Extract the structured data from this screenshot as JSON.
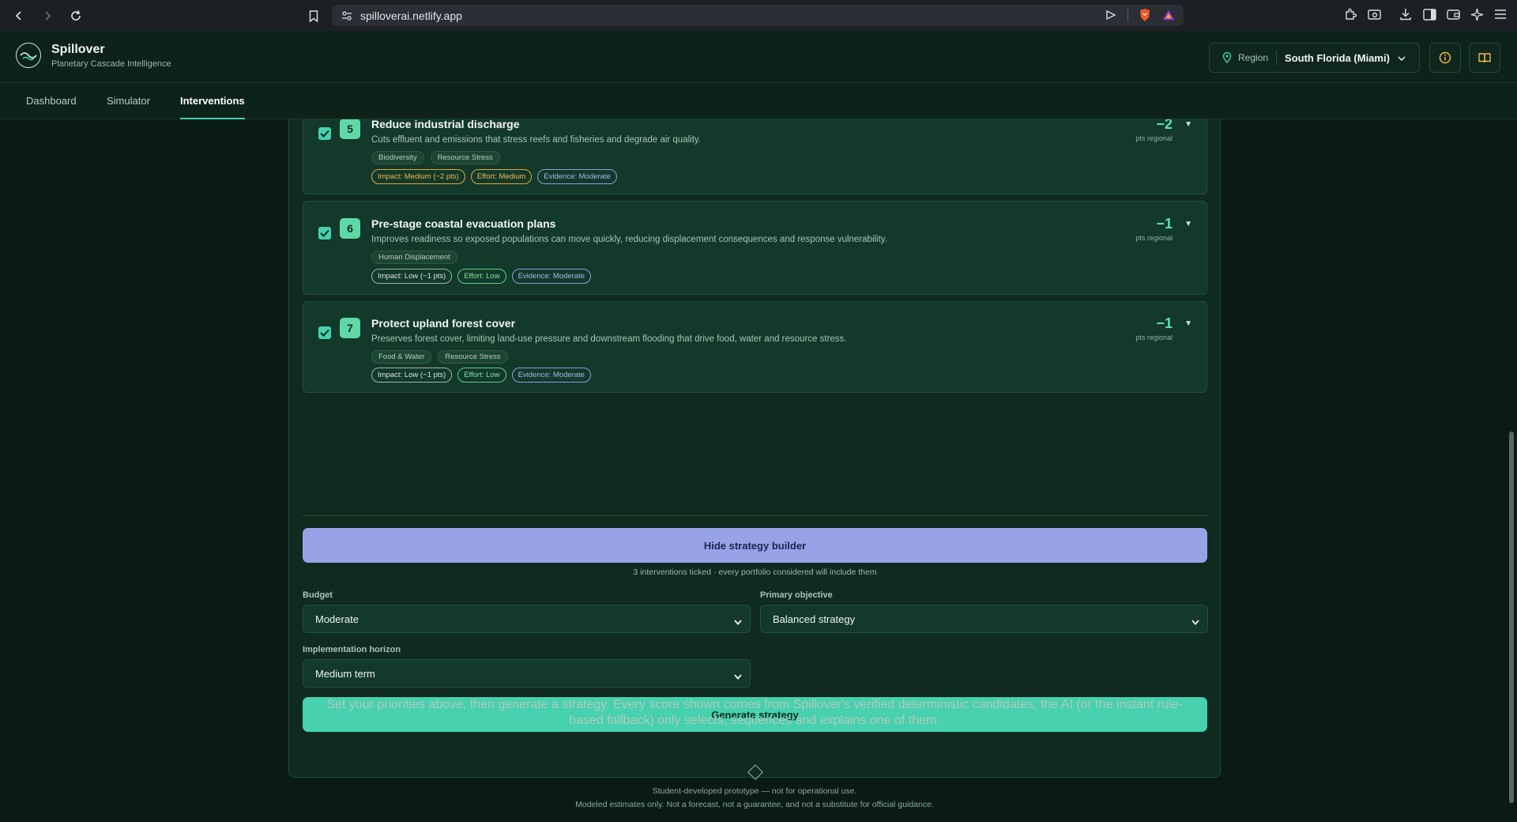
{
  "browser": {
    "url": "spilloverai.netlify.app"
  },
  "app": {
    "name": "Spillover",
    "tagline": "Planetary Cascade Intelligence",
    "region_label": "Region",
    "region_value": "South Florida (Miami)"
  },
  "tabs": [
    {
      "label": "Dashboard"
    },
    {
      "label": "Simulator"
    },
    {
      "label": "Interventions"
    }
  ],
  "interventions": [
    {
      "number": "5",
      "title": "Reduce industrial discharge",
      "description": "Cuts effluent and emissions that stress reefs and fisheries and degrade air quality.",
      "tags": [
        "Biodiversity",
        "Resource Stress"
      ],
      "impact": "Impact: Medium (−2 pts)",
      "effort": "Effort: Medium",
      "evidence": "Evidence: Moderate",
      "score": "−2",
      "score_unit": "pts regional",
      "checked": true
    },
    {
      "number": "6",
      "title": "Pre-stage coastal evacuation plans",
      "description": "Improves readiness so exposed populations can move quickly, reducing displacement consequences and response vulnerability.",
      "tags": [
        "Human Displacement"
      ],
      "impact": "Impact: Low (−1 pts)",
      "effort": "Effort: Low",
      "evidence": "Evidence: Moderate",
      "score": "−1",
      "score_unit": "pts regional",
      "checked": true
    },
    {
      "number": "7",
      "title": "Protect upland forest cover",
      "description": "Preserves forest cover, limiting land-use pressure and downstream flooding that drive food, water and resource stress.",
      "tags": [
        "Food & Water",
        "Resource Stress"
      ],
      "impact": "Impact: Low (−1 pts)",
      "effort": "Effort: Low",
      "evidence": "Evidence: Moderate",
      "score": "−1",
      "score_unit": "pts regional",
      "checked": true
    }
  ],
  "strategy": {
    "hide_button": "Hide strategy builder",
    "ticked_note": "3 interventions ticked · every portfolio considered will include them",
    "budget_label": "Budget",
    "budget_value": "Moderate",
    "objective_label": "Primary objective",
    "objective_value": "Balanced strategy",
    "horizon_label": "Implementation horizon",
    "horizon_value": "Medium term",
    "generate_button": "Generate strategy",
    "empty_text": "Set your priorities above, then generate a strategy. Every score shown comes from Spillover's verified deterministic candidates, the AI (or the instant rule-based fallback) only selects, sequences and explains one of them."
  },
  "footer": {
    "line1": "Student-developed prototype — not for operational use.",
    "line2": "Modeled estimates only. Not a forecast, not a guarantee, and not a substitute for official guidance."
  },
  "colors": {
    "accent": "#47d1ae",
    "secondary": "#98a2e6",
    "background": "#0a1b14"
  }
}
